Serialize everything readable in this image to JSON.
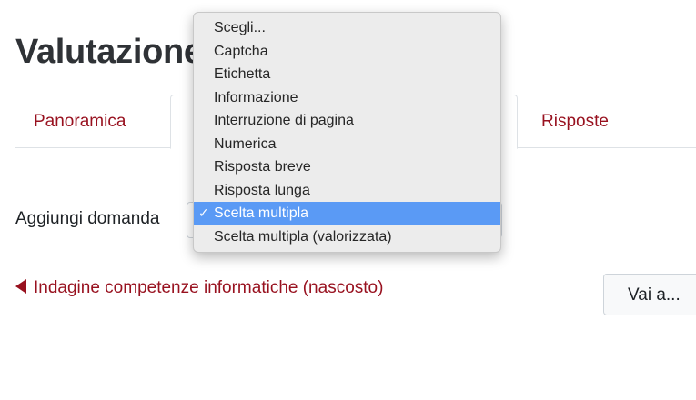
{
  "page": {
    "title": "Valutazione"
  },
  "tabs": [
    {
      "label": "Panoramica"
    },
    {
      "label": ""
    },
    {
      "label": "Risposte"
    }
  ],
  "add_question": {
    "label": "Aggiungi domanda",
    "selected_value": "Scelta multipla"
  },
  "dropdown": {
    "options": [
      {
        "label": "Scegli..."
      },
      {
        "label": "Captcha"
      },
      {
        "label": "Etichetta"
      },
      {
        "label": "Informazione"
      },
      {
        "label": "Interruzione di pagina"
      },
      {
        "label": "Numerica"
      },
      {
        "label": "Risposta breve"
      },
      {
        "label": "Risposta lunga"
      },
      {
        "label": "Scelta multipla",
        "selected": true
      },
      {
        "label": "Scelta multipla (valorizzata)"
      }
    ],
    "checkmark": "✓"
  },
  "nav": {
    "back_link": "Indagine competenze informatiche (nascosto)",
    "back_icon": "triangle-left-icon",
    "goto_label": "Vai a..."
  },
  "colors": {
    "link": "#98111f",
    "highlight": "#5a9af5"
  }
}
